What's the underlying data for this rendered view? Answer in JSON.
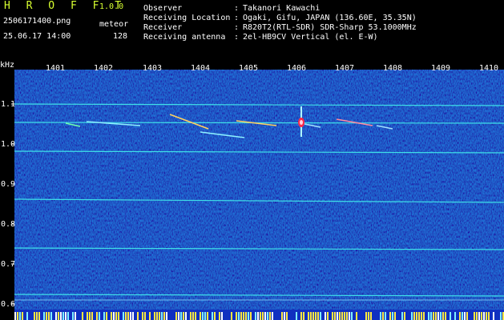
{
  "app": {
    "title": "H R O F F T",
    "version": "1.0.0"
  },
  "capture": {
    "file_name": "2506171400.png",
    "datetime": "25.06.17 14:00",
    "mode": "meteor",
    "count": "128"
  },
  "meta": [
    {
      "label": "Observer",
      "value": "Takanori Kawachi"
    },
    {
      "label": "Receiving Location",
      "value": "Ogaki, Gifu, JAPAN (136.60E, 35.35N)"
    },
    {
      "label": "Receiver",
      "value": "R820T2(RTL-SDR) SDR-Sharp 53.1000MHz"
    },
    {
      "label": "Receiving antenna",
      "value": "2el-HB9CV Vertical (el. E-W)"
    }
  ],
  "colon": ":",
  "axis": {
    "unit": "kHz",
    "x_ticks": [
      "1401",
      "1402",
      "1403",
      "1404",
      "1405",
      "1406",
      "1407",
      "1408",
      "1409",
      "1410"
    ],
    "y_ticks": [
      "1.1",
      "1.0",
      "0.9",
      "0.8",
      "0.7",
      "0.6"
    ]
  },
  "colors": {
    "background": "#000000",
    "noise": "#0a1a8a",
    "carrier": "#3fe0e8",
    "echo": "#ff2a4a",
    "header_accent": "#d8ff30"
  }
}
